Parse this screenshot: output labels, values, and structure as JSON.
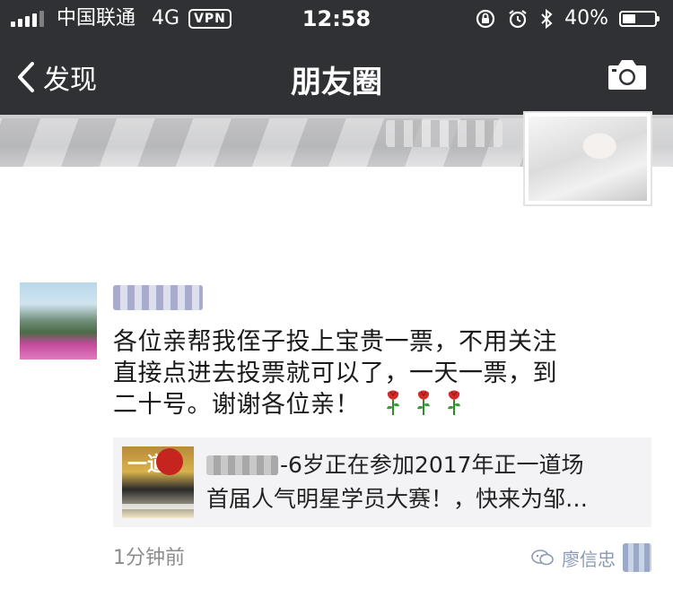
{
  "status_bar": {
    "carrier": "中国联通",
    "network": "4G",
    "vpn": "VPN",
    "time": "12:58",
    "battery": "40%",
    "battery_level": 0.4,
    "icons": [
      "signal-icon",
      "lock-rotation-icon",
      "alarm-icon",
      "bluetooth-icon",
      "battery-icon"
    ]
  },
  "nav": {
    "back_label": "发现",
    "title": "朋友圈",
    "icons": [
      "back-chevron-icon",
      "camera-icon"
    ]
  },
  "post": {
    "text_line1": "各位亲帮我侄子投上宝贵一票，不用关注",
    "text_line2": "直接点进去投票就可以了，一天一票，到",
    "text_line3": "二十号。谢谢各位亲！",
    "emoji": [
      "rose-icon",
      "rose-icon",
      "rose-icon"
    ],
    "link": {
      "title_line1": "-6岁正在参加2017年正一道场",
      "title_line2": "首届人气明星学员大赛！，快来为邹…",
      "thumb_text": "一道"
    },
    "time_ago": "1分钟前"
  },
  "watermark": {
    "text": "廖信忠",
    "icon": "wechat-channel-icon"
  },
  "colors": {
    "header_bg": "#2f3135",
    "header_text": "#ffffff",
    "link_card_bg": "#f3f3f5",
    "timestamp": "#8c8c8c"
  }
}
